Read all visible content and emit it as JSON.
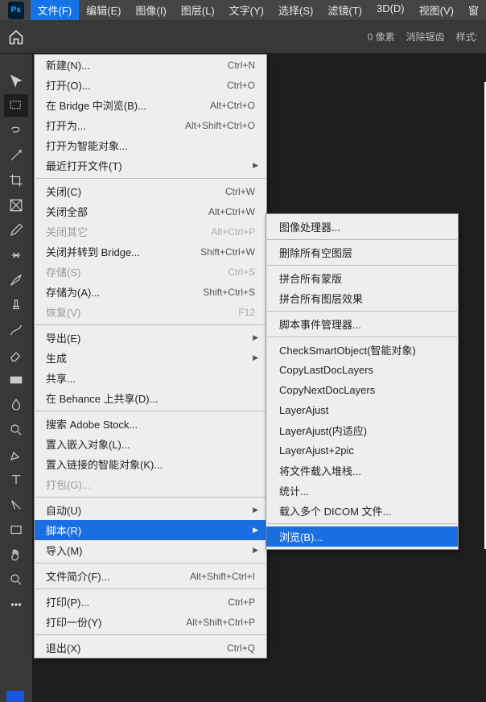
{
  "menubar": {
    "items": [
      "文件(F)",
      "编辑(E)",
      "图像(I)",
      "图层(L)",
      "文字(Y)",
      "选择(S)",
      "滤镜(T)",
      "3D(D)",
      "视图(V)",
      "窗"
    ]
  },
  "optionbar": {
    "px_label": "0 像素",
    "antialias": "消除锯齿",
    "style": "样式:"
  },
  "file_menu": [
    {
      "type": "item",
      "label": "新建(N)...",
      "shortcut": "Ctrl+N"
    },
    {
      "type": "item",
      "label": "打开(O)...",
      "shortcut": "Ctrl+O"
    },
    {
      "type": "item",
      "label": "在 Bridge 中浏览(B)...",
      "shortcut": "Alt+Ctrl+O"
    },
    {
      "type": "item",
      "label": "打开为...",
      "shortcut": "Alt+Shift+Ctrl+O"
    },
    {
      "type": "item",
      "label": "打开为智能对象..."
    },
    {
      "type": "sub",
      "label": "最近打开文件(T)"
    },
    {
      "type": "sep"
    },
    {
      "type": "item",
      "label": "关闭(C)",
      "shortcut": "Ctrl+W"
    },
    {
      "type": "item",
      "label": "关闭全部",
      "shortcut": "Alt+Ctrl+W"
    },
    {
      "type": "item",
      "label": "关闭其它",
      "shortcut": "Alt+Ctrl+P",
      "disabled": true
    },
    {
      "type": "item",
      "label": "关闭并转到 Bridge...",
      "shortcut": "Shift+Ctrl+W"
    },
    {
      "type": "item",
      "label": "存储(S)",
      "shortcut": "Ctrl+S",
      "disabled": true
    },
    {
      "type": "item",
      "label": "存储为(A)...",
      "shortcut": "Shift+Ctrl+S"
    },
    {
      "type": "item",
      "label": "恢复(V)",
      "shortcut": "F12",
      "disabled": true
    },
    {
      "type": "sep"
    },
    {
      "type": "sub",
      "label": "导出(E)"
    },
    {
      "type": "sub",
      "label": "生成"
    },
    {
      "type": "item",
      "label": "共享..."
    },
    {
      "type": "item",
      "label": "在 Behance 上共享(D)..."
    },
    {
      "type": "sep"
    },
    {
      "type": "item",
      "label": "搜索 Adobe Stock..."
    },
    {
      "type": "item",
      "label": "置入嵌入对象(L)..."
    },
    {
      "type": "item",
      "label": "置入链接的智能对象(K)..."
    },
    {
      "type": "item",
      "label": "打包(G)...",
      "disabled": true
    },
    {
      "type": "sep"
    },
    {
      "type": "sub",
      "label": "自动(U)"
    },
    {
      "type": "sub",
      "label": "脚本(R)",
      "highlight": true
    },
    {
      "type": "sub",
      "label": "导入(M)"
    },
    {
      "type": "sep"
    },
    {
      "type": "item",
      "label": "文件简介(F)...",
      "shortcut": "Alt+Shift+Ctrl+I"
    },
    {
      "type": "sep"
    },
    {
      "type": "item",
      "label": "打印(P)...",
      "shortcut": "Ctrl+P"
    },
    {
      "type": "item",
      "label": "打印一份(Y)",
      "shortcut": "Alt+Shift+Ctrl+P"
    },
    {
      "type": "sep"
    },
    {
      "type": "item",
      "label": "退出(X)",
      "shortcut": "Ctrl+Q"
    }
  ],
  "submenu": [
    {
      "type": "item",
      "label": "图像处理器..."
    },
    {
      "type": "sep"
    },
    {
      "type": "item",
      "label": "删除所有空图层"
    },
    {
      "type": "sep"
    },
    {
      "type": "item",
      "label": "拼合所有蒙版"
    },
    {
      "type": "item",
      "label": "拼合所有图层效果"
    },
    {
      "type": "sep"
    },
    {
      "type": "item",
      "label": "脚本事件管理器..."
    },
    {
      "type": "sep"
    },
    {
      "type": "item",
      "label": "CheckSmartObject(智能对象)"
    },
    {
      "type": "item",
      "label": "CopyLastDocLayers"
    },
    {
      "type": "item",
      "label": "CopyNextDocLayers"
    },
    {
      "type": "item",
      "label": "LayerAjust"
    },
    {
      "type": "item",
      "label": "LayerAjust(内适应)"
    },
    {
      "type": "item",
      "label": "LayerAjust+2pic"
    },
    {
      "type": "item",
      "label": "将文件载入堆栈..."
    },
    {
      "type": "item",
      "label": "统计..."
    },
    {
      "type": "item",
      "label": "载入多个 DICOM 文件..."
    },
    {
      "type": "sep"
    },
    {
      "type": "item",
      "label": "浏览(B)...",
      "highlight": true
    }
  ],
  "tools": [
    "move",
    "marquee",
    "lasso",
    "wand",
    "crop",
    "frame",
    "eyedrop",
    "heal",
    "brush",
    "stamp",
    "history",
    "eraser",
    "gradient",
    "blur",
    "dodge",
    "pen",
    "type",
    "path",
    "rect",
    "hand",
    "zoom",
    "more"
  ]
}
